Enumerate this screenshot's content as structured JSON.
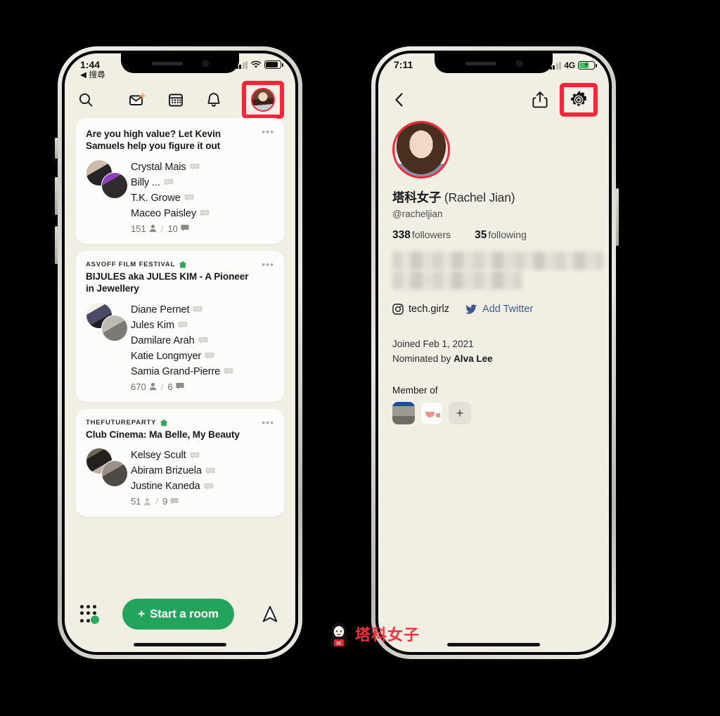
{
  "colors": {
    "highlight_red": "#fb2438",
    "app_bg": "#f1eee4",
    "card_bg": "#fcfcfa",
    "accent_green": "#22a45d",
    "club_house_green": "#2fa85a",
    "twitter_blue": "#3b5a8f"
  },
  "left_phone": {
    "status": {
      "time": "1:44",
      "back_label": "◀ 搜尋",
      "signal_icon": "cellular-bars-icon",
      "wifi_icon": "wifi-icon",
      "battery_icon": "battery-icon"
    },
    "topbar": {
      "search_icon": "search-icon",
      "invite_icon": "invite-envelope-icon",
      "calendar_icon": "calendar-icon",
      "bell_icon": "bell-icon",
      "profile_icon": "profile-avatar-icon",
      "highlighted": "profile-avatar"
    },
    "cards": [
      {
        "club": "",
        "title": "Are you high value? Let Kevin Samuels help you figure it out",
        "speakers": [
          "Crystal Mais",
          "Billy ...",
          "T.K. Growe",
          "Maceo Paisley"
        ],
        "listeners": "151",
        "speakers_count": "10"
      },
      {
        "club": "ASVOFF FILM FESTIVAL",
        "title": "BIJULES aka JULES KIM - A Pioneer in Jewellery",
        "speakers": [
          "Diane Pernet",
          "Jules Kim",
          "Damilare Arah",
          "Katie Longmyer",
          "Samia Grand-Pierre"
        ],
        "listeners": "670",
        "speakers_count": "6"
      },
      {
        "club": "THEFUTUREPARTY",
        "title": "Club Cinema: Ma Belle, My Beauty",
        "speakers": [
          "Kelsey Scult",
          "Abiram Brizuela",
          "Justine Kaneda"
        ],
        "listeners": "51",
        "speakers_count": "9"
      }
    ],
    "bottombar": {
      "dotgrid_icon": "people-dot-grid-icon",
      "start_room_label": "Start a room",
      "start_room_plus": "+",
      "share_icon": "paper-plane-icon"
    }
  },
  "right_phone": {
    "status": {
      "time": "7:11",
      "network": "4G",
      "signal_icon": "cellular-bars-icon",
      "battery_icon": "battery-charging-icon"
    },
    "topbar": {
      "back_icon": "chevron-left-icon",
      "share_icon": "share-upload-icon",
      "settings_icon": "gear-icon",
      "highlighted": "settings-gear"
    },
    "profile": {
      "avatar_icon": "profile-photo",
      "name_cn": "塔科女子",
      "name_en": "(Rachel Jian)",
      "handle": "@racheljian",
      "followers_count": "338",
      "followers_label": "followers",
      "following_count": "35",
      "following_label": "following",
      "bio_blurred": true,
      "instagram_icon": "instagram-icon",
      "instagram_handle": "tech.girlz",
      "twitter_icon": "twitter-bird-icon",
      "twitter_label": "Add Twitter",
      "joined": "Joined Feb 1, 2021",
      "nominated_prefix": "Nominated by",
      "nominated_by": "Alva Lee",
      "member_of_label": "Member of",
      "member_clubs": [
        "club-icon-1",
        "club-icon-2",
        "add-club-plus"
      ],
      "add_club_plus": "+"
    }
  },
  "watermark": {
    "text": "塔科女子",
    "avatar_icon": "watermark-avatar-icon"
  }
}
